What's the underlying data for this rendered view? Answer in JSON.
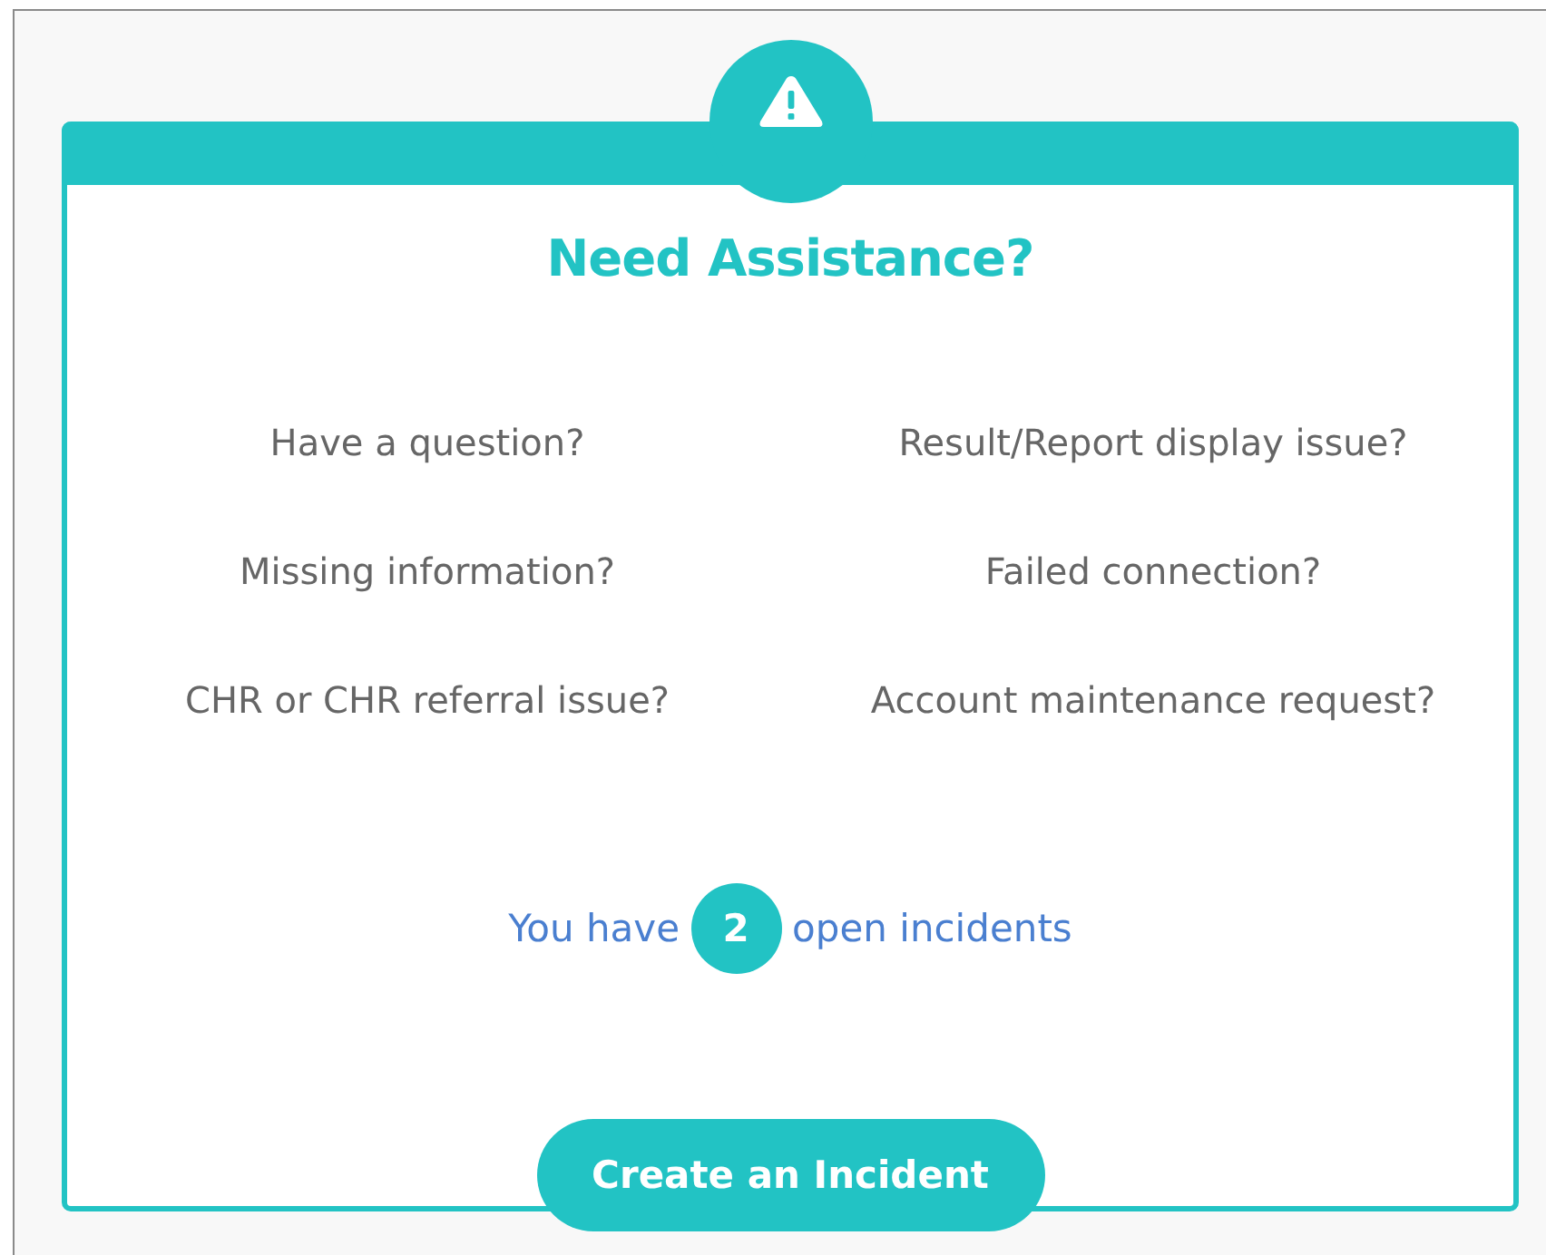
{
  "title": "Need Assistance?",
  "questions": [
    "Have a question?",
    "Result/Report display issue?",
    "Missing information?",
    "Failed connection?",
    "CHR or CHR referral issue?",
    "Account maintenance request?"
  ],
  "incidents": {
    "prefix": "You have",
    "count": "2",
    "suffix": "open incidents"
  },
  "button": "Create an Incident"
}
